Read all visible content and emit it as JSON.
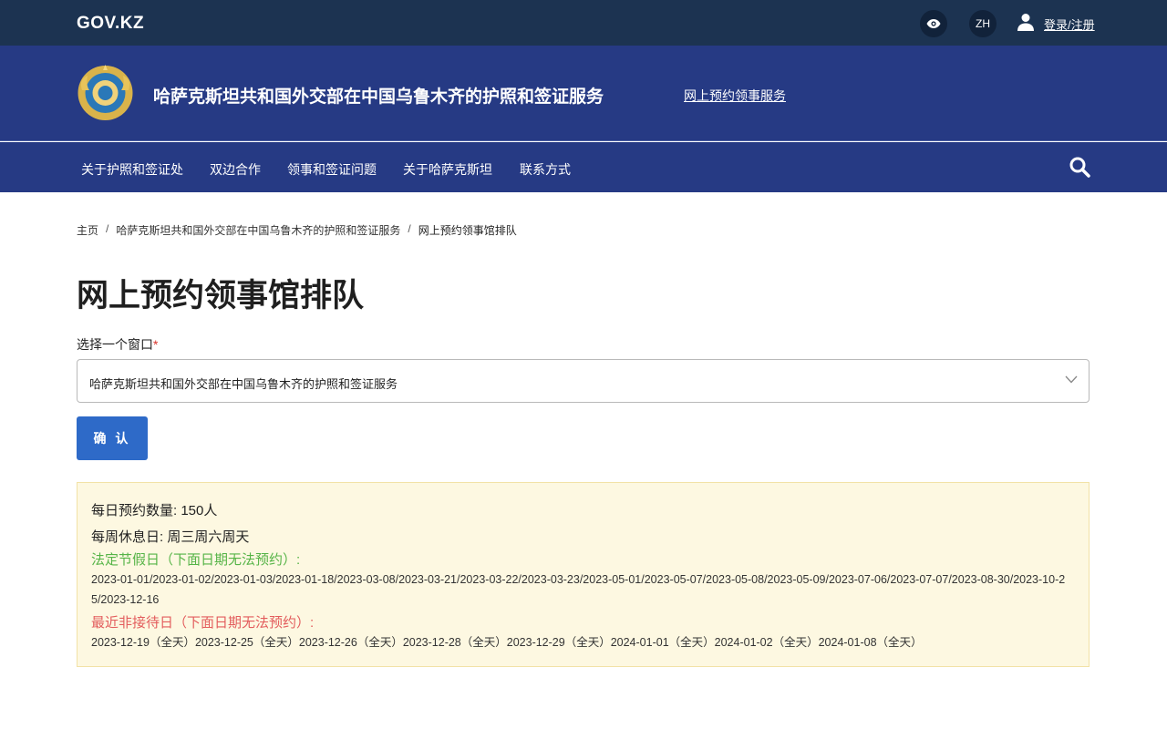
{
  "topbar": {
    "logo": "GOV.KZ",
    "lang": "ZH",
    "login": "登录/注册",
    "icons": [
      "eye-icon",
      "user-icon"
    ]
  },
  "header": {
    "title": "哈萨克斯坦共和国外交部在中国乌鲁木齐的护照和签证服务",
    "link": "网上预约领事服务"
  },
  "nav": {
    "items": [
      "关于护照和签证处",
      "双边合作",
      "领事和签证问题",
      "关于哈萨克斯坦",
      "联系方式"
    ]
  },
  "breadcrumb": {
    "home": "主页",
    "section": "哈萨克斯坦共和国外交部在中国乌鲁木齐的护照和签证服务",
    "current": "网上预约领事馆排队"
  },
  "page": {
    "title": "网上预约领事馆排队",
    "field_label": "选择一个窗口",
    "required_mark": "*",
    "select_value": "哈萨克斯坦共和国外交部在中国乌鲁木齐的护照和签证服务",
    "confirm": "确 认"
  },
  "info": {
    "daily": "每日预约数量: 150人",
    "weekly": "每周休息日: 周三周六周天",
    "holidays_title": "法定节假日（下面日期无法预约）:",
    "holidays": "2023-01-01/2023-01-02/2023-01-03/2023-01-18/2023-03-08/2023-03-21/2023-03-22/2023-03-23/2023-05-01/2023-05-07/2023-05-08/2023-05-09/2023-07-06/2023-07-07/2023-08-30/2023-10-25/2023-12-16",
    "closed_title": "最近非接待日（下面日期无法预约）:",
    "closed": "2023-12-19（全天）2023-12-25（全天）2023-12-26（全天）2023-12-28（全天）2023-12-29（全天）2024-01-01（全天）2024-01-02（全天）2024-01-08（全天）"
  },
  "colors": {
    "topbar": "#1c3351",
    "header": "#263a84",
    "button": "#2e6ac8",
    "info_bg": "#fdf8e1",
    "green": "#56b447",
    "red": "#e35d5d"
  }
}
